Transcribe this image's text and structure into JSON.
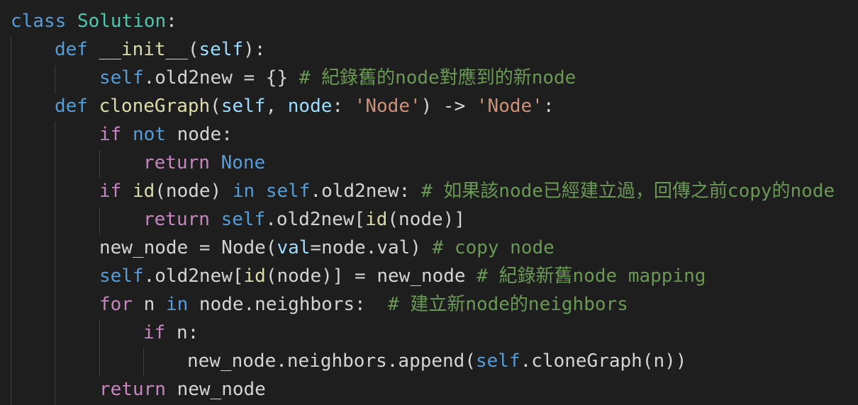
{
  "code": {
    "l1": {
      "kw": "class",
      "sp": " ",
      "name": "Solution",
      "colon": ":"
    },
    "l2": {
      "kw": "def",
      "sp": " ",
      "fn": "__init__",
      "open": "(",
      "self": "self",
      "close": "):"
    },
    "l3": {
      "self": "self",
      "rest": ".old2new = {} ",
      "comment": "# 紀錄舊的node對應到的新node"
    },
    "l4": {
      "kw": "def",
      "sp": " ",
      "fn": "cloneGraph",
      "open": "(",
      "self": "self",
      "comma": ", ",
      "node": "node",
      "c": ": ",
      "s1": "'Node'",
      "arrow": ") -> ",
      "s2": "'Node'",
      "end": ":"
    },
    "l5": {
      "kw1": "if",
      "sp1": " ",
      "kw2": "not",
      "rest": " node:"
    },
    "l6": {
      "kw1": "return",
      "sp": " ",
      "kw2": "None"
    },
    "l7": {
      "kw1": "if",
      "sp1": " ",
      "fn": "id",
      "p1": "(node) ",
      "kw2": "in",
      "sp2": " ",
      "self": "self",
      "rest": ".old2new: ",
      "comment": "# 如果該node已經建立過，回傳之前copy的node"
    },
    "l8": {
      "kw": "return",
      "sp": " ",
      "self": "self",
      "a": ".old2new[",
      "fn": "id",
      "b": "(node)]"
    },
    "l9": {
      "a": "new_node = Node(",
      "param": "val",
      "b": "=node.val) ",
      "comment": "# copy node"
    },
    "l10": {
      "self": "self",
      "a": ".old2new[",
      "fn": "id",
      "b": "(node)] = new_node ",
      "comment": "# 紀錄新舊node mapping"
    },
    "l11": {
      "kw1": "for",
      "a": " n ",
      "kw2": "in",
      "b": " node.neighbors:  ",
      "comment": "# 建立新node的neighbors"
    },
    "l12": {
      "kw": "if",
      "a": " n:"
    },
    "l13": {
      "a": "new_node.neighbors.append(",
      "self": "self",
      "b": ".cloneGraph(n))"
    },
    "l14": {
      "kw": "return",
      "a": " new_node"
    }
  },
  "colors": {
    "background": "#1e1e1e",
    "keyword_blue": "#569cd6",
    "keyword_purple": "#c586c0",
    "class_name": "#4ec9b0",
    "function": "#dcdcaa",
    "parameter": "#9cdcfe",
    "string": "#ce9178",
    "comment": "#6a9955",
    "text": "#d4d4d4"
  }
}
